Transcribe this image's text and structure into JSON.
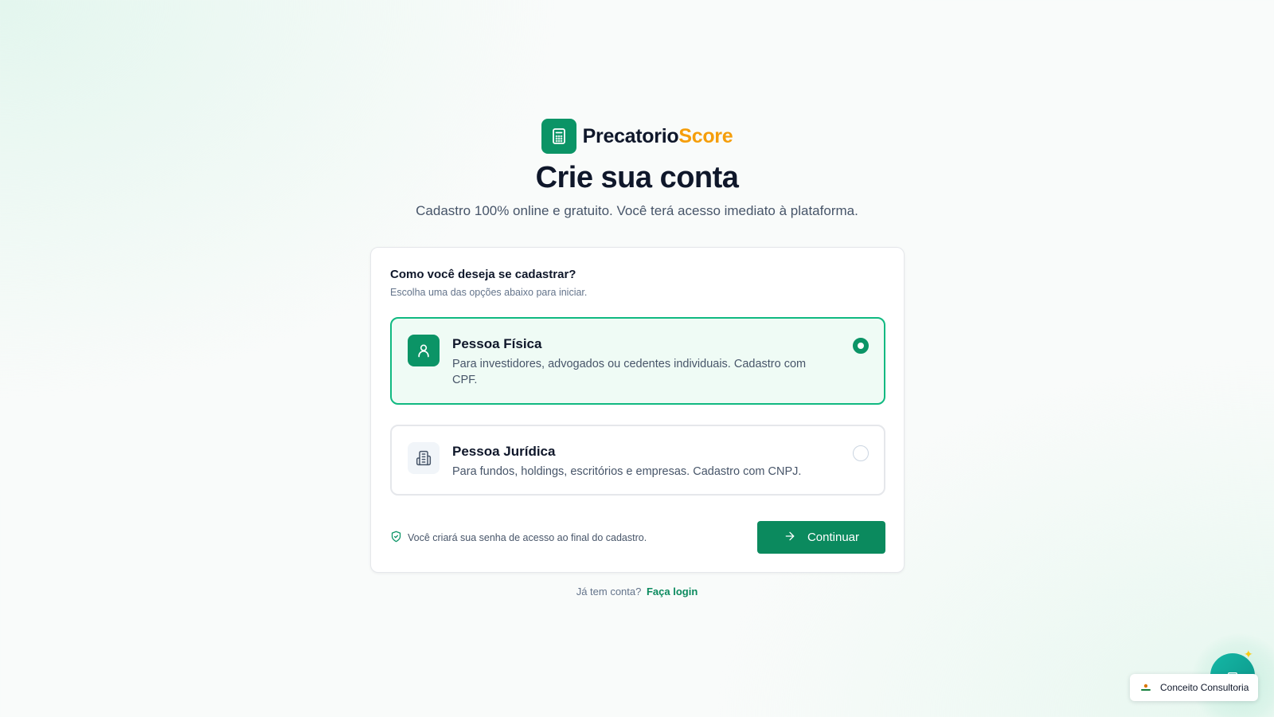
{
  "brand": {
    "name_part1": "Precatorio",
    "name_part2": "Score",
    "accent_color": "#f59e0b",
    "primary_color": "#0b9466",
    "icon": "calculator-icon"
  },
  "header": {
    "title": "Crie sua conta",
    "subtitle": "Cadastro 100% online e gratuito. Você terá acesso imediato à plataforma."
  },
  "form": {
    "question": "Como você deseja se cadastrar?",
    "hint": "Escolha uma das opções abaixo para iniciar.",
    "options": [
      {
        "title": "Pessoa Física",
        "description": "Para investidores, advogados ou cedentes individuais. Cadastro com CPF.",
        "icon": "user-icon",
        "selected": true
      },
      {
        "title": "Pessoa Jurídica",
        "description": "Para fundos, holdings, escritórios e empresas. Cadastro com CNPJ.",
        "icon": "building-icon",
        "selected": false
      }
    ],
    "security_note": "Você criará sua senha de acesso ao final do cadastro.",
    "continue_label": "Continuar"
  },
  "footer": {
    "login_prompt": "Já tem conta?",
    "login_link": "Faça login"
  },
  "widget": {
    "badge_label": "Conceito Consultoria"
  }
}
